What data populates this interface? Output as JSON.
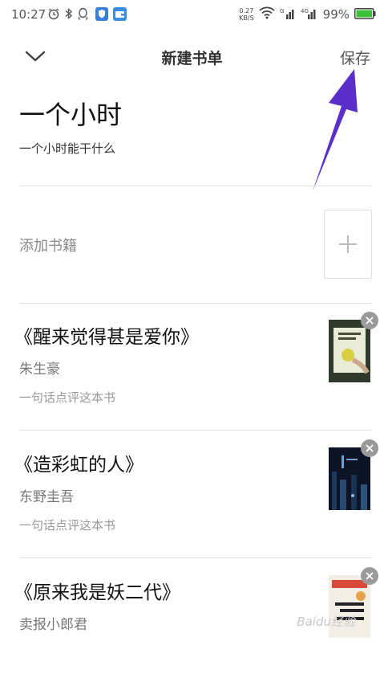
{
  "status_bar": {
    "time": "10:27",
    "net_speed_value": "0.27",
    "net_speed_unit": "KB/S",
    "battery_percent": "99%",
    "battery_color": "#3cc13c"
  },
  "header": {
    "title": "新建书单",
    "save_label": "保存"
  },
  "annotation": {
    "arrow_color": "#5b2fc9"
  },
  "booklist": {
    "name": "一个小时",
    "description": "一个小时能干什么"
  },
  "add_book": {
    "label": "添加书籍"
  },
  "books": [
    {
      "title": "《醒来觉得甚是爱你》",
      "author": "朱生豪",
      "comment_placeholder": "一句话点评这本书"
    },
    {
      "title": "《造彩虹的人》",
      "author": "东野圭吾",
      "comment_placeholder": "一句话点评这本书"
    },
    {
      "title": "《原来我是妖二代》",
      "author": "卖报小郎君"
    }
  ],
  "watermark": "Baidu经验"
}
